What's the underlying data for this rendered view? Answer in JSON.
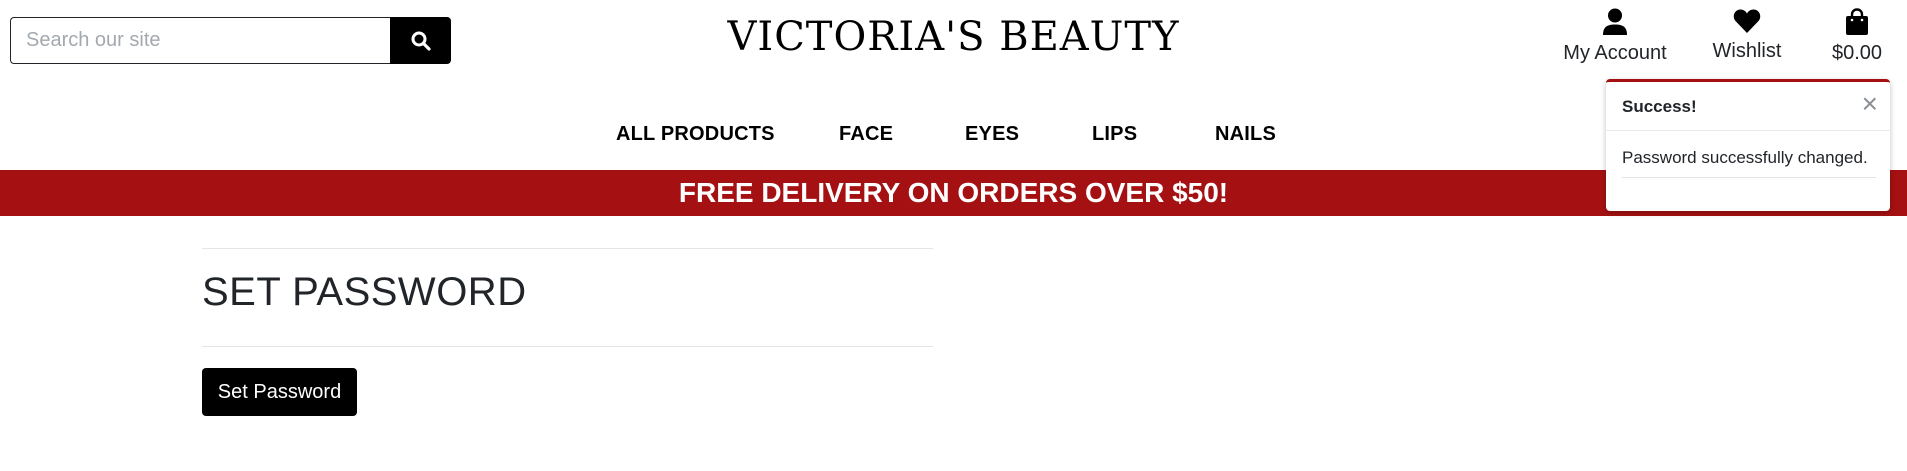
{
  "search": {
    "placeholder": "Search our site"
  },
  "brand": {
    "name": "VICTORIA'S BEAUTY"
  },
  "header": {
    "account_label": "My Account",
    "wishlist_label": "Wishlist",
    "bag_total": "$0.00"
  },
  "nav": {
    "items": [
      {
        "label": "ALL PRODUCTS"
      },
      {
        "label": "FACE"
      },
      {
        "label": "EYES"
      },
      {
        "label": "LIPS"
      },
      {
        "label": "NAILS"
      }
    ]
  },
  "banner": {
    "text": "FREE DELIVERY ON ORDERS OVER $50!"
  },
  "main": {
    "title": "SET PASSWORD",
    "button_label": "Set Password"
  },
  "toast": {
    "title": "Success!",
    "close": "×",
    "message": "Password successfully changed."
  },
  "colors": {
    "accent": "#a51112",
    "primary_button": "#000000"
  },
  "icons": [
    "search-icon",
    "user-icon",
    "heart-icon",
    "shopping-bag-icon",
    "close-icon"
  ]
}
